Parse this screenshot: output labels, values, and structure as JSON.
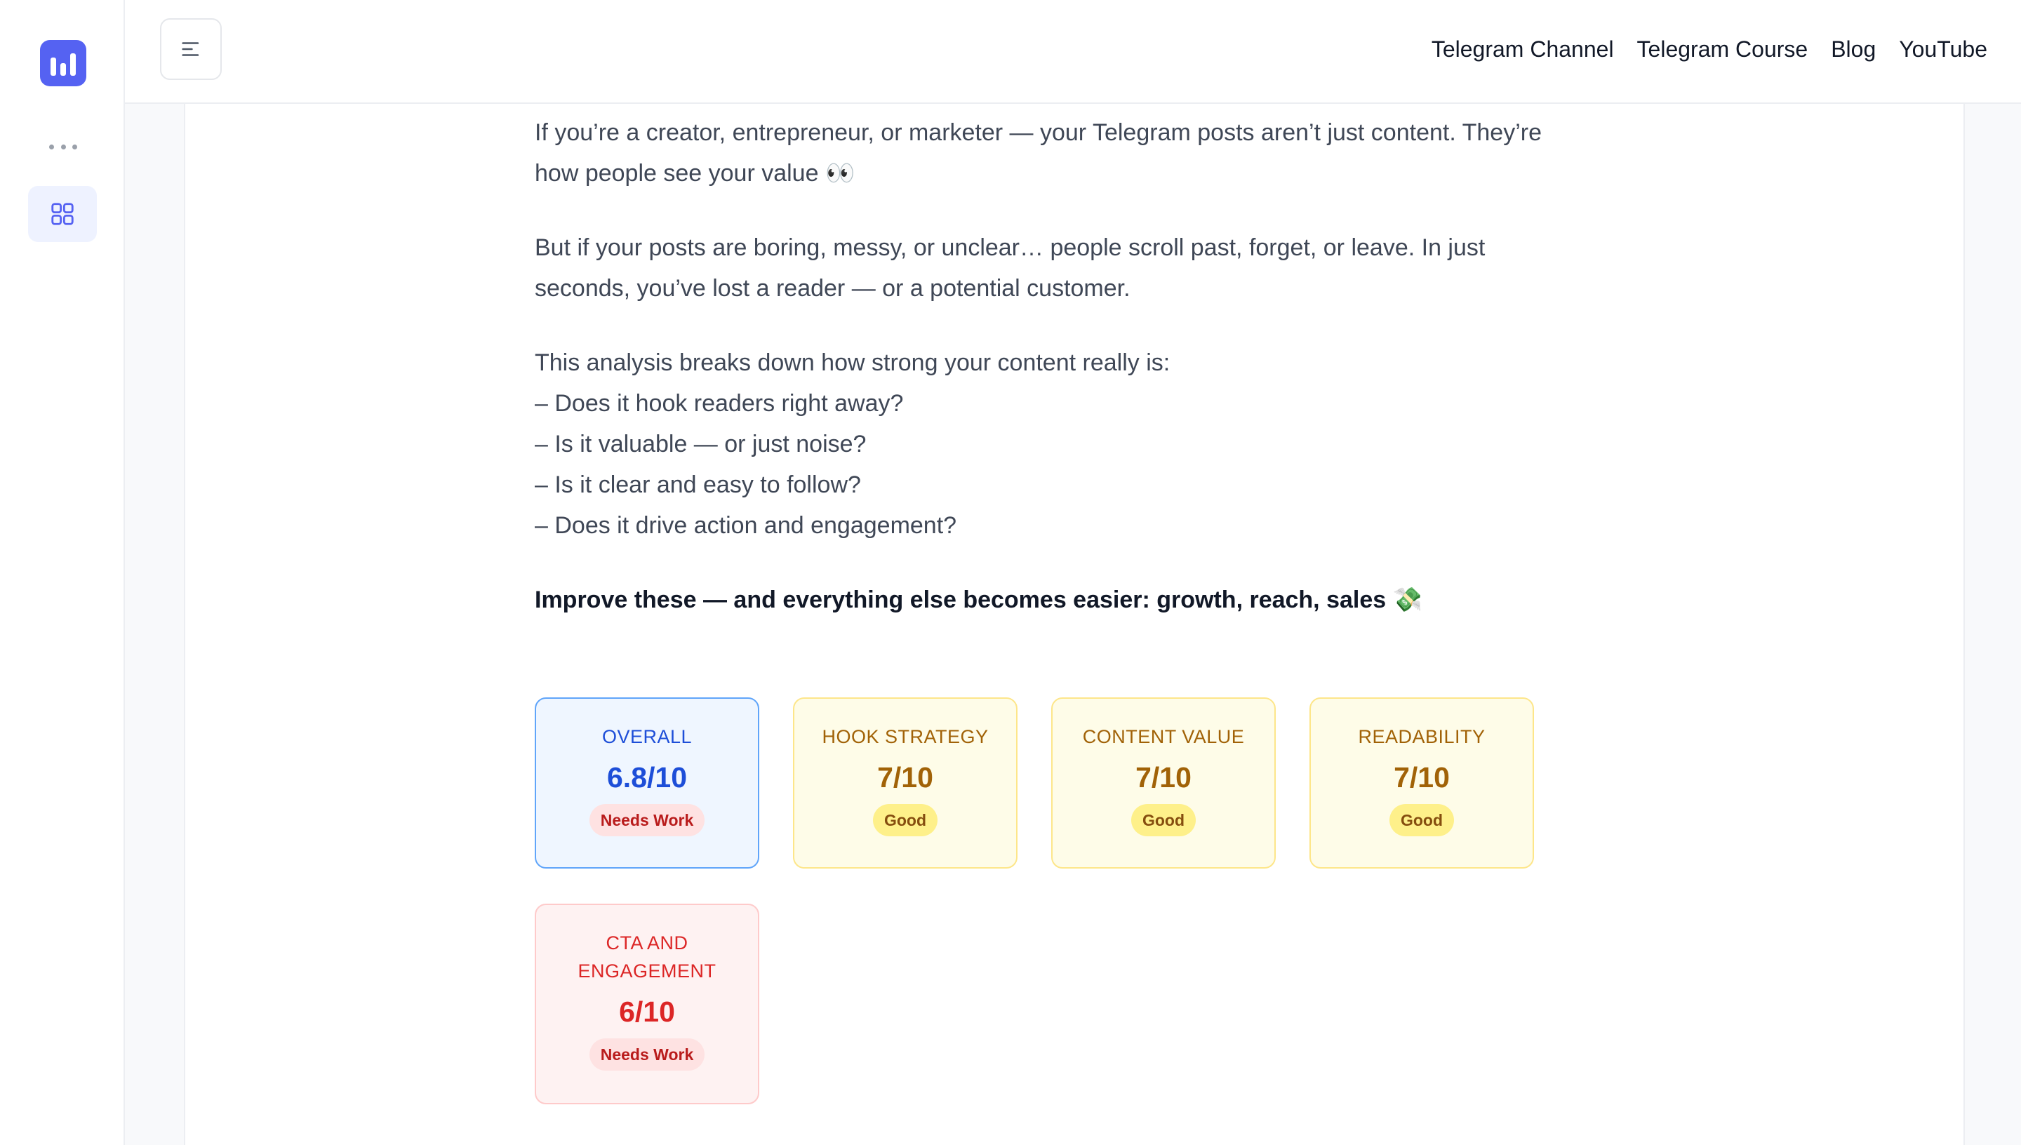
{
  "sidebar": {
    "logo_icon": "bar-chart-logo-icon",
    "more_icon": "more-dots-icon",
    "items": [
      {
        "icon": "grid-icon",
        "active": true
      }
    ]
  },
  "header": {
    "menu_icon": "menu-icon",
    "nav": [
      {
        "label": "Telegram Channel"
      },
      {
        "label": "Telegram Course"
      },
      {
        "label": "Blog"
      },
      {
        "label": "YouTube"
      }
    ]
  },
  "content": {
    "intro_1_line1": " If you’re a creator, entrepreneur, or marketer — your Telegram posts aren’t just content. They’re",
    "intro_1_line2": "how people see your value 👀",
    "intro_2_line1": " But if your posts are boring, messy, or unclear… people scroll past, forget, or leave. In just",
    "intro_2_line2": "seconds, you’ve lost a reader — or a potential customer.",
    "analysis_intro": " This analysis breaks down how strong your content really is:",
    "questions": [
      "– Does it hook readers right away?",
      "– Is it valuable — or just noise?",
      "– Is it clear and easy to follow?",
      "– Does it drive action and engagement?"
    ],
    "conclusion": " Improve these — and everything else becomes easier: growth, reach, sales 💸"
  },
  "scores": [
    {
      "label": "OVERALL",
      "score": "6.8/10",
      "badge": "Needs Work",
      "color": "#1d4ed8"
    },
    {
      "label": "HOOK STRATEGY",
      "score": "7/10",
      "badge": "Good",
      "color": "#a16207"
    },
    {
      "label": "CONTENT VALUE",
      "score": "7/10",
      "badge": "Good",
      "color": "#a16207"
    },
    {
      "label": "READABILITY",
      "score": "7/10",
      "badge": "Good",
      "color": "#a16207"
    },
    {
      "label_line1": "CTA AND",
      "label_line2": "ENGAGEMENT",
      "score": "6/10",
      "badge": "Needs Work",
      "color": "#dc2626"
    }
  ],
  "colors": {
    "accent": "#5562f2",
    "overall": "#1d4ed8",
    "good": "#a16207",
    "needs_work": "#dc2626"
  }
}
